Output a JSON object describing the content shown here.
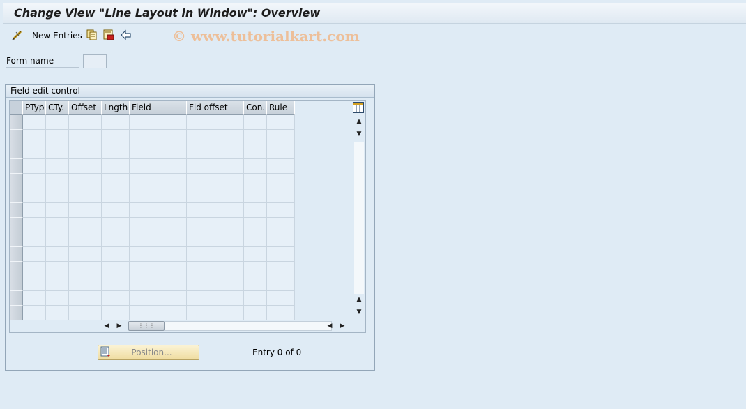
{
  "window": {
    "title": "Change View \"Line Layout in Window\": Overview"
  },
  "toolbar": {
    "new_entries_label": "New Entries",
    "watermark": "© www.tutorialkart.com"
  },
  "form": {
    "form_name_label": "Form name",
    "form_name_value": ""
  },
  "group": {
    "title": "Field edit control"
  },
  "table": {
    "columns": [
      "PTyp",
      "CTy.",
      "Offset",
      "Lngth",
      "Field",
      "Fld offset",
      "Con.",
      "Rule"
    ],
    "row_count": 14
  },
  "footer": {
    "position_label": "Position...",
    "entry_text": "Entry 0 of 0"
  }
}
